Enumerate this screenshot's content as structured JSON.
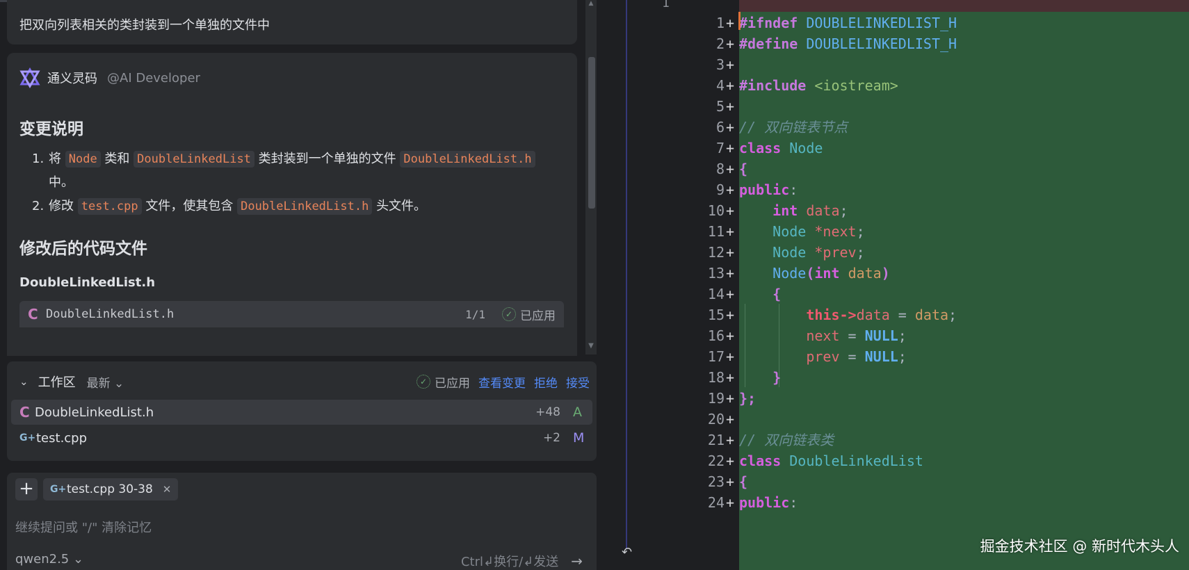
{
  "chat": {
    "user_message": "把双向列表相关的类封装到一个单独的文件中",
    "ai_name": "通义灵码",
    "ai_handle": "@AI Developer",
    "section_changes": "变更说明",
    "change_items": [
      {
        "num": "1.",
        "t1": "将",
        "c1": "Node",
        "t2": "类和",
        "c2": "DoubleLinkedList",
        "t3": "类封装到一个单独的文件",
        "c3": "DoubleLinkedList.h",
        "t4": "中。"
      },
      {
        "num": "2.",
        "t1": "修改",
        "c1": "test.cpp",
        "t2": "文件，使其包含",
        "c2": "DoubleLinkedList.h",
        "t3": "头文件。"
      }
    ],
    "section_files": "修改后的代码文件",
    "file_heading": "DoubleLinkedList.h",
    "file_chip": {
      "icon": "C",
      "name": "DoubleLinkedList.h",
      "count": "1/1",
      "status": "已应用"
    }
  },
  "workspace": {
    "title": "工作区",
    "filter": "最新",
    "status": "已应用",
    "view_changes": "查看变更",
    "reject": "拒绝",
    "accept": "接受",
    "files": [
      {
        "icon": "C",
        "name": "DoubleLinkedList.h",
        "delta": "+48",
        "badge": "A"
      },
      {
        "icon": "G+",
        "name": "test.cpp",
        "delta": "+2",
        "badge": "M"
      }
    ]
  },
  "input": {
    "context_chip": "test.cpp 30-38",
    "placeholder": "继续提问或 \"/\" 清除记忆",
    "model": "qwen2.5",
    "send_hint": "Ctrl↲换行/↲发送"
  },
  "editor": {
    "left_line_number": "1",
    "lines": [
      {
        "n": "1",
        "m": "+"
      },
      {
        "n": "2",
        "m": "+"
      },
      {
        "n": "3",
        "m": "+"
      },
      {
        "n": "4",
        "m": "+"
      },
      {
        "n": "5",
        "m": "+"
      },
      {
        "n": "6",
        "m": "+"
      },
      {
        "n": "7",
        "m": "+"
      },
      {
        "n": "8",
        "m": "+"
      },
      {
        "n": "9",
        "m": "+"
      },
      {
        "n": "10",
        "m": "+"
      },
      {
        "n": "11",
        "m": "+"
      },
      {
        "n": "12",
        "m": "+"
      },
      {
        "n": "13",
        "m": "+"
      },
      {
        "n": "14",
        "m": "+"
      },
      {
        "n": "15",
        "m": "+"
      },
      {
        "n": "16",
        "m": "+"
      },
      {
        "n": "17",
        "m": "+"
      },
      {
        "n": "18",
        "m": "+"
      },
      {
        "n": "19",
        "m": "+"
      },
      {
        "n": "20",
        "m": "+"
      },
      {
        "n": "21",
        "m": "+"
      },
      {
        "n": "22",
        "m": "+"
      },
      {
        "n": "23",
        "m": "+"
      },
      {
        "n": "24",
        "m": "+"
      }
    ],
    "code": {
      "l1_kw": "#ifndef",
      "l1_id": "DOUBLELINKEDLIST_H",
      "l2_kw": "#define",
      "l2_id": "DOUBLELINKEDLIST_H",
      "l4_kw": "#include",
      "l4_hdr": "<iostream>",
      "l6_cm": "// 双向链表节点",
      "l7_kw": "class",
      "l7_id": "Node",
      "l8": "{",
      "l9_kw": "public",
      "l9_p": ":",
      "l10_t": "int",
      "l10_v": "data",
      "l10_p": ";",
      "l11_t": "Node",
      "l11_v": "*next",
      "l11_p": ";",
      "l12_t": "Node",
      "l12_v": "*prev",
      "l12_p": ";",
      "l13_f": "Node",
      "l13_o": "(",
      "l13_t": "int",
      "l13_v": "data",
      "l13_c": ")",
      "l14": "{",
      "l15_this": "this->",
      "l15_v": "data",
      "l15_eq": " = ",
      "l15_r": "data",
      "l15_p": ";",
      "l16_v": "next",
      "l16_eq": " = ",
      "l16_r": "NULL",
      "l16_p": ";",
      "l17_v": "prev",
      "l17_eq": " = ",
      "l17_r": "NULL",
      "l17_p": ";",
      "l18": "}",
      "l19": "};",
      "l21_cm": "// 双向链表类",
      "l22_kw": "class",
      "l22_id": "DoubleLinkedList",
      "l23": "{",
      "l24_kw": "public",
      "l24_p": ":"
    }
  },
  "watermark": "掘金技术社区 @ 新时代木头人"
}
